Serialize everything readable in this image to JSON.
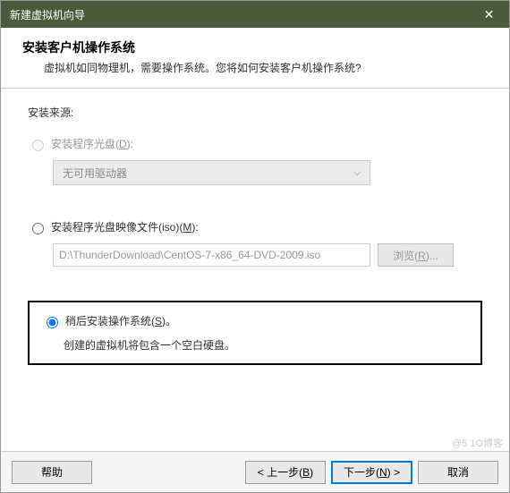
{
  "titlebar": {
    "title": "新建虚拟机向导"
  },
  "header": {
    "title": "安装客户机操作系统",
    "desc": "虚拟机如同物理机，需要操作系统。您将如何安装客户机操作系统?"
  },
  "content": {
    "source_label": "安装来源:",
    "opt1": {
      "label_pre": "安装程序光盘(",
      "label_key": "D",
      "label_post": "):",
      "dropdown_text": "无可用驱动器"
    },
    "opt2": {
      "label_pre": "安装程序光盘映像文件(iso)(",
      "label_key": "M",
      "label_post": "):",
      "path": "D:\\ThunderDownload\\CentOS-7-x86_64-DVD-2009.iso",
      "browse_pre": "浏览(",
      "browse_key": "R",
      "browse_post": ")..."
    },
    "opt3": {
      "label_pre": "稍后安装操作系统(",
      "label_key": "S",
      "label_post": ")。",
      "desc": "创建的虚拟机将包含一个空白硬盘。"
    }
  },
  "footer": {
    "help": "帮助",
    "back_pre": "< 上一步(",
    "back_key": "B",
    "back_post": ")",
    "next_pre": "下一步(",
    "next_key": "N",
    "next_post": ") >",
    "cancel": "取消"
  },
  "watermark": "@5  1O博客"
}
